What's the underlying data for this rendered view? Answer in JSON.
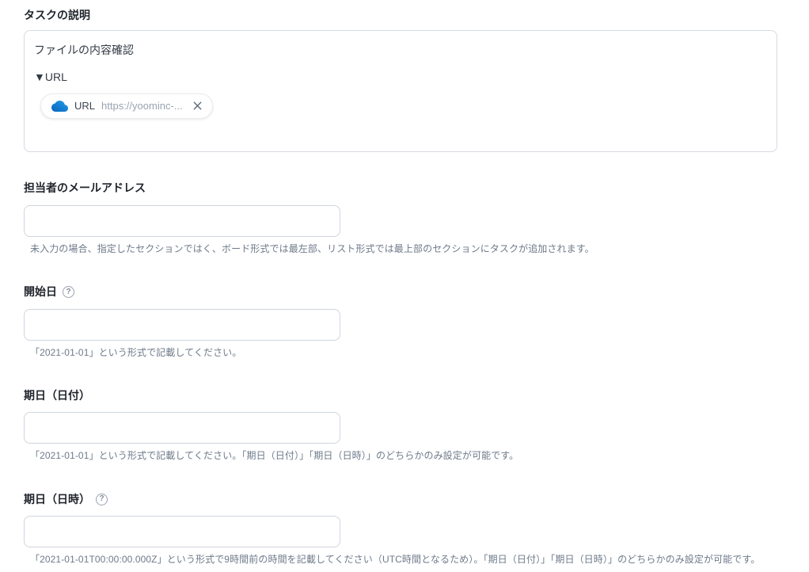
{
  "fields": {
    "description": {
      "label": "タスクの説明",
      "content_line1": "ファイルの内容確認",
      "content_line2": "▼URL",
      "chip": {
        "icon": "onedrive-cloud-icon",
        "label": "URL",
        "url": "https://yoominc-..."
      }
    },
    "email": {
      "label": "担当者のメールアドレス",
      "value": "",
      "helper": "未入力の場合、指定したセクションではく、ボード形式では最左部、リスト形式では最上部のセクションにタスクが追加されます。"
    },
    "start_date": {
      "label": "開始日",
      "help_glyph": "?",
      "value": "",
      "helper": "「2021-01-01」という形式で記載してください。"
    },
    "due_date": {
      "label": "期日（日付）",
      "value": "",
      "helper": "「2021-01-01」という形式で記載してください。「期日（日付）」「期日（日時）」のどちらかのみ設定が可能です。"
    },
    "due_datetime": {
      "label": "期日（日時）",
      "help_glyph": "?",
      "value": "",
      "helper": "「2021-01-01T00:00:00.000Z」という形式で9時間前の時間を記載してください（UTC時間となるため）。「期日（日付）」「期日（日時）」のどちらかのみ設定が可能です。"
    }
  },
  "colors": {
    "cloud_gradient_start": "#0a64bd",
    "cloud_gradient_end": "#2e9fe8",
    "input_border": "#cfd5de",
    "helper_text": "#6e7a8a"
  }
}
